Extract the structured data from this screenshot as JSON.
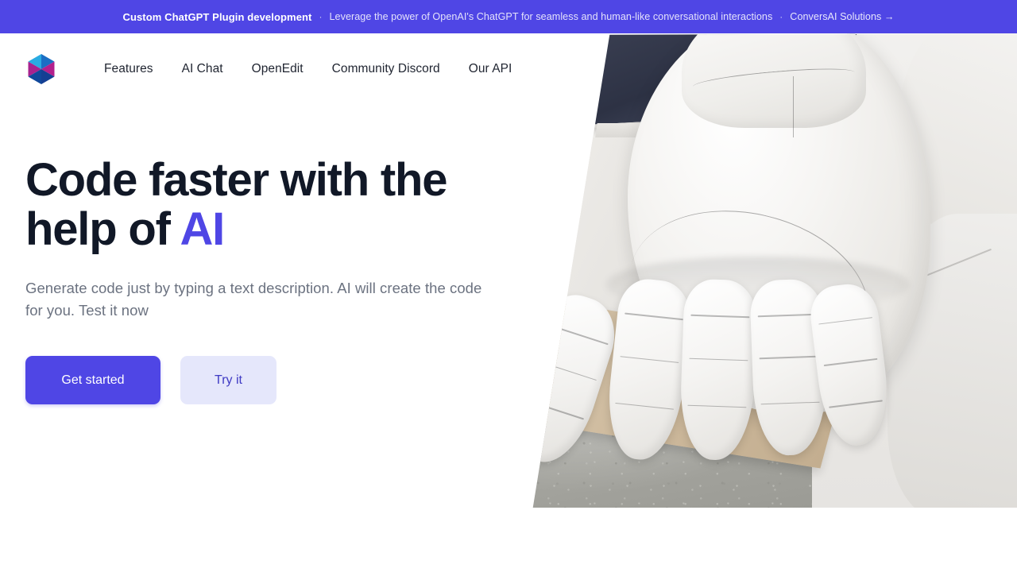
{
  "announcement": {
    "strong": "Custom ChatGPT Plugin development",
    "separator_1": "·",
    "text": "Leverage the power of OpenAI's ChatGPT for seamless and human-like conversational interactions",
    "separator_2": "·",
    "link": "ConversAI Solutions →",
    "background_color": "#4f46e5"
  },
  "nav": {
    "logo_name": "hexagon-pinwheel-logo",
    "links": [
      {
        "label": "Features"
      },
      {
        "label": "AI Chat"
      },
      {
        "label": "OpenEdit"
      },
      {
        "label": "Community Discord"
      },
      {
        "label": "Our API"
      }
    ]
  },
  "hero": {
    "headline_line1": "Code faster with the",
    "headline_line2_prefix": "help of ",
    "headline_accent": "AI",
    "accent_color": "#4f46e5",
    "subhead": "Generate code just by typing a text description. AI will create the code for you. Test it now",
    "primary_cta": "Get started",
    "secondary_cta": "Try it",
    "image_alt": "white-robotic-hand-resting-on-wooden-plank"
  }
}
